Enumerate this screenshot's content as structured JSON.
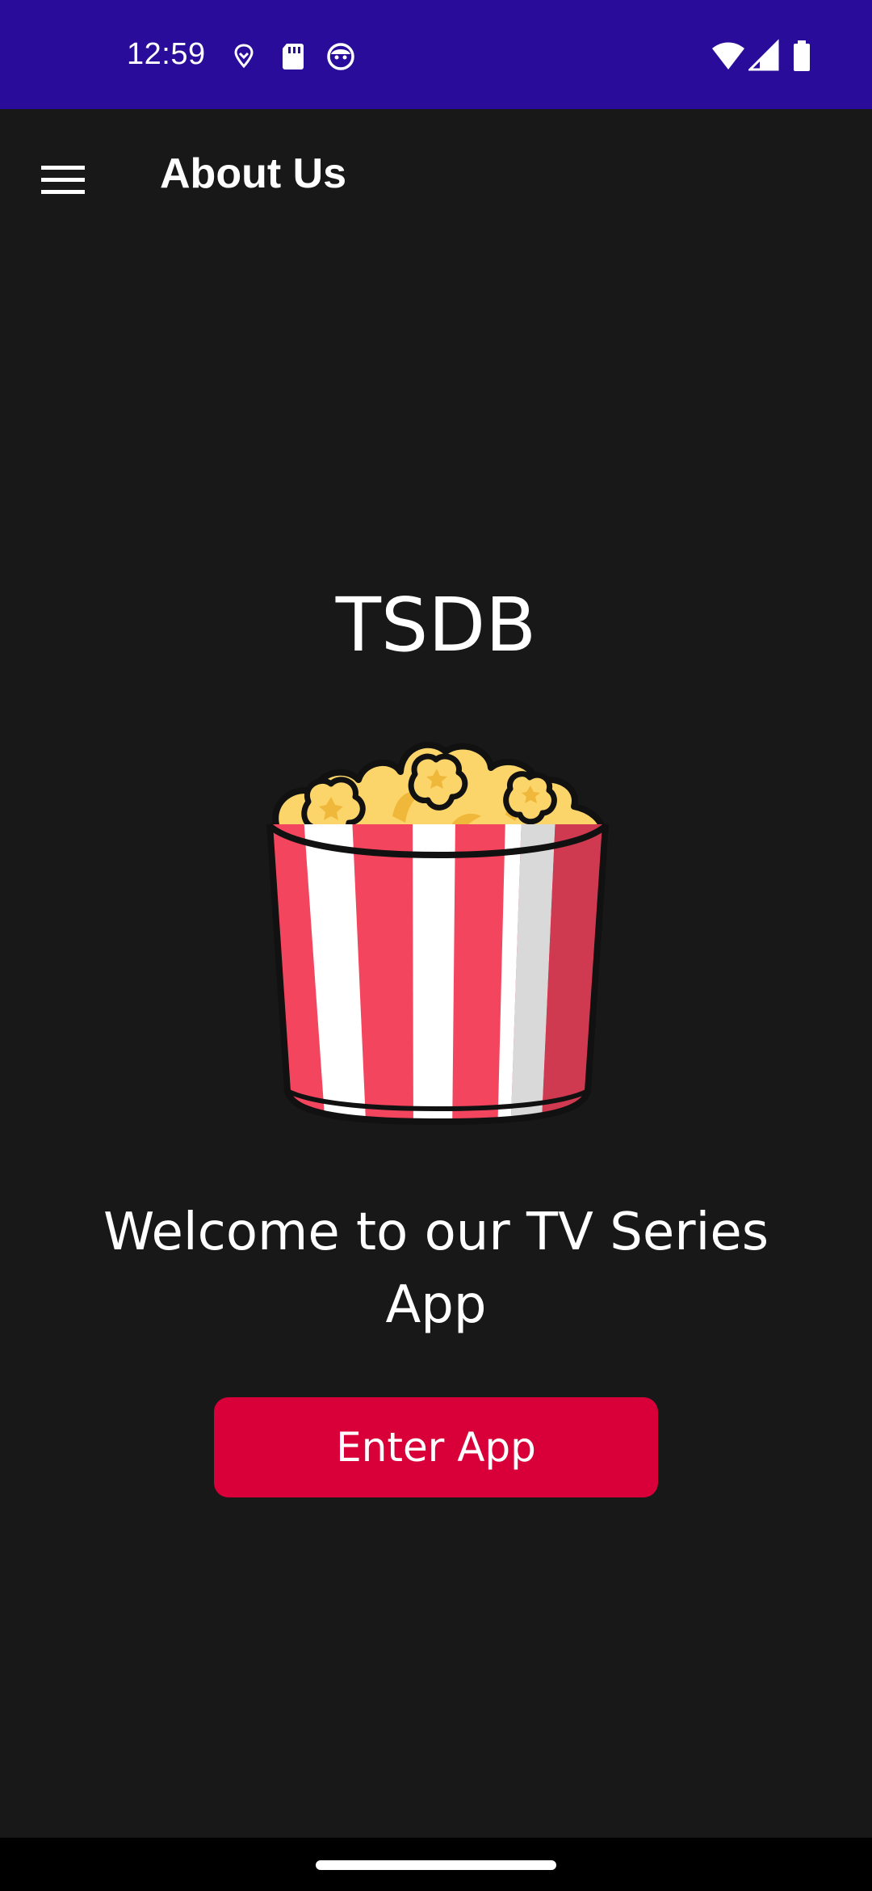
{
  "status_bar": {
    "time": "12:59",
    "background": "#2a0c9a",
    "left_icons": [
      "location-pin-icon",
      "sd-card-icon",
      "assistant-face-icon"
    ],
    "right_icons": [
      "wifi-icon",
      "cell-signal-icon",
      "battery-icon"
    ]
  },
  "app_bar": {
    "title": "About Us",
    "menu_icon": "menu-icon"
  },
  "main": {
    "brand": "TSDB",
    "illustration": "popcorn-bucket-icon",
    "welcome_text": "Welcome to our TV Series App",
    "button_label": "Enter App",
    "button_color": "#d9003a"
  },
  "nav": {
    "handle": "home-gesture-handle"
  }
}
